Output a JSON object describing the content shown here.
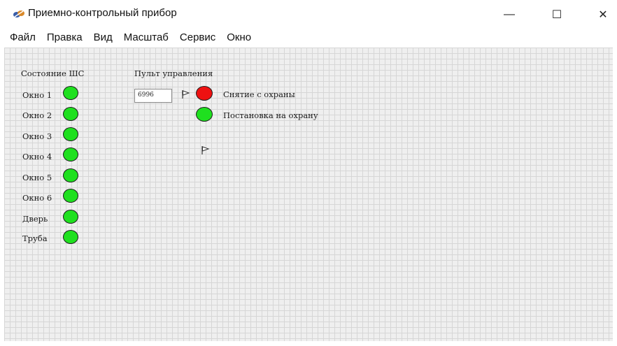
{
  "window": {
    "title": "Приемно-контрольный прибор",
    "minimize": "—",
    "maximize": "☐",
    "close": "✕"
  },
  "menu": [
    "Файл",
    "Правка",
    "Вид",
    "Масштаб",
    "Сервис",
    "Окно"
  ],
  "zones": {
    "heading": "Состояние ШС",
    "items": [
      {
        "label": "Окно 1",
        "state": "ok"
      },
      {
        "label": "Окно 2",
        "state": "ok"
      },
      {
        "label": "Окно 3",
        "state": "ok"
      },
      {
        "label": "Окно 4",
        "state": "ok"
      },
      {
        "label": "Окно 5",
        "state": "ok"
      },
      {
        "label": "Окно 6",
        "state": "ok"
      },
      {
        "label": "Дверь",
        "state": "ok"
      },
      {
        "label": "Труба",
        "state": "ok"
      }
    ]
  },
  "control": {
    "heading": "Пульт управления",
    "code_value": "6996",
    "disarm_label": "Снятие с охраны",
    "arm_label": "Постановка на охрану",
    "disarm_state": "active",
    "arm_state": "ok"
  },
  "colors": {
    "led_green": "#1fe01f",
    "led_red": "#ee1111"
  },
  "icons": {
    "app": "app-logo-icon",
    "flag": "flag-icon"
  }
}
